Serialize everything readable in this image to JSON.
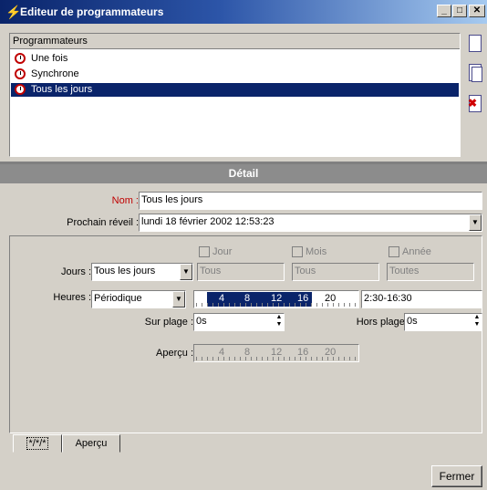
{
  "window": {
    "title": "Editeur de programmateurs",
    "icon": "scheduler-icon"
  },
  "list": {
    "header": "Programmateurs",
    "items": [
      {
        "label": "Une fois",
        "icon": "clock-icon",
        "selected": false
      },
      {
        "label": "Synchrone",
        "icon": "clock-icon",
        "selected": false
      },
      {
        "label": "Tous les jours",
        "icon": "clock-icon",
        "selected": true
      }
    ]
  },
  "detail": {
    "header": "Détail",
    "nom_label": "Nom :",
    "nom_value": "Tous les jours",
    "prochain_label": "Prochain réveil :",
    "prochain_value": "lundi 18 février 2002 12:53:23"
  },
  "panel": {
    "jour_label": "Jour",
    "mois_label": "Mois",
    "annee_label": "Année",
    "jours_label": "Jours :",
    "jours_value": "Tous les jours",
    "jour_field": "Tous",
    "mois_field": "Tous",
    "annee_field": "Toutes",
    "heures_label": "Heures :",
    "heures_value": "Périodique",
    "timeline_ticks": [
      "4",
      "8",
      "12",
      "16",
      "20"
    ],
    "time_range": "2:30-16:30",
    "sur_plage_label": "Sur plage :",
    "sur_plage_value": "0s",
    "hors_plage_label": "Hors plage :",
    "hors_plage_value": "0s",
    "apercu_label": "Aperçu :"
  },
  "tabs": [
    "*/*/*",
    "Aperçu"
  ],
  "fermer": "Fermer",
  "colors": {
    "titlebar": "#0a246a",
    "selection": "#0a246a",
    "nom_label": "#c00000"
  }
}
